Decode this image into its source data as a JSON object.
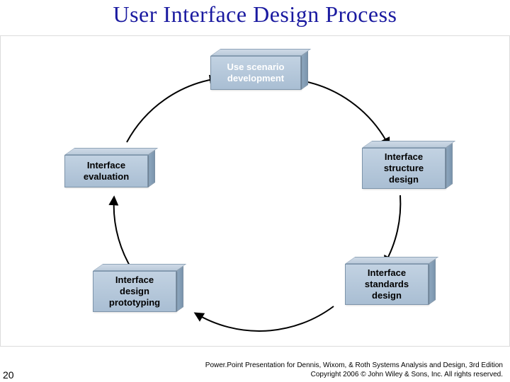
{
  "slide": {
    "title": "User Interface Design Process",
    "page_number": "20",
    "footer_line1": "Power.Point Presentation for Dennis, Wixom, & Roth Systems Analysis and Design, 3rd Edition",
    "footer_line2": "Copyright 2006 © John Wiley & Sons, Inc.  All rights reserved."
  },
  "cycle": {
    "nodes": [
      {
        "id": "use-scenario",
        "label": "Use scenario\ndevelopment"
      },
      {
        "id": "structure-design",
        "label": "Interface\nstructure\ndesign"
      },
      {
        "id": "standards-design",
        "label": "Interface\nstandards\ndesign"
      },
      {
        "id": "design-prototyping",
        "label": "Interface\ndesign\nprototyping"
      },
      {
        "id": "evaluation",
        "label": "Interface\nevaluation"
      }
    ],
    "direction": "clockwise"
  }
}
